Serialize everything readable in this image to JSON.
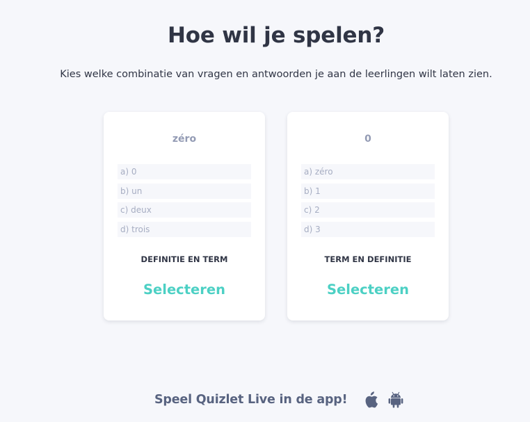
{
  "header": {
    "title": "Hoe wil je spelen?",
    "subtitle": "Kies welke combinatie van vragen en antwoorden je aan de leerlingen wilt laten zien."
  },
  "cards": [
    {
      "prompt": "zéro",
      "answers": [
        "a) 0",
        "b) un",
        "c) deux",
        "d) trois"
      ],
      "mode_label": "DEFINITIE EN TERM",
      "select_label": "Selecteren"
    },
    {
      "prompt": "0",
      "answers": [
        "a) zéro",
        "b) 1",
        "c) 2",
        "d) 3"
      ],
      "mode_label": "TERM EN DEFINITIE",
      "select_label": "Selecteren"
    }
  ],
  "footer": {
    "text": "Speel Quizlet Live in de app!",
    "icons": [
      "apple-icon",
      "android-icon"
    ]
  },
  "colors": {
    "background": "#f6f7fb",
    "accent": "#4cd0c4",
    "heading": "#303545",
    "muted": "#939bb4",
    "footer_text": "#586380"
  }
}
